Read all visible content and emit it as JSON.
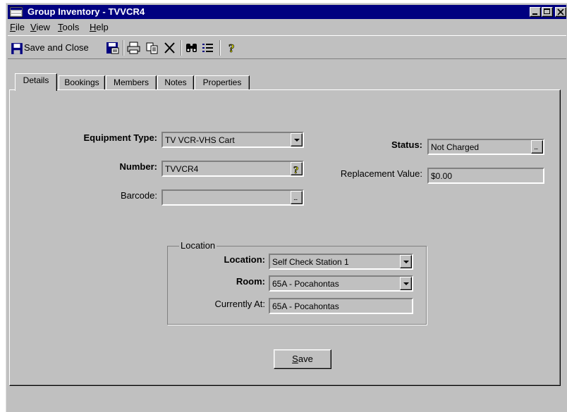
{
  "window": {
    "title": "Group Inventory - TVVCR4"
  },
  "menu": [
    {
      "label": "File",
      "hotkey": "F",
      "rest": "ile"
    },
    {
      "label": "View",
      "hotkey": "V",
      "rest": "iew"
    },
    {
      "label": "Tools",
      "hotkey": "T",
      "rest": "ools"
    },
    {
      "label": "Help",
      "hotkey": "H",
      "rest": "elp"
    }
  ],
  "toolbar": {
    "save_close_label": "Save and Close",
    "icons": [
      "save-disk-icon",
      "save-new-icon",
      "print-icon",
      "copy-icon",
      "delete-icon",
      "find-binoculars-icon",
      "list-icon",
      "help-question-icon"
    ]
  },
  "tabs": [
    "Details",
    "Bookings",
    "Members",
    "Notes",
    "Properties"
  ],
  "active_tab": "Details",
  "details": {
    "equipment_type_label": "Equipment Type:",
    "equipment_type_value": "TV VCR-VHS Cart",
    "number_label": "Number:",
    "number_value": "TVVCR4",
    "barcode_label": "Barcode:",
    "barcode_value": "",
    "status_label": "Status:",
    "status_value": "Not Charged",
    "replacement_label": "Replacement Value:",
    "replacement_value": "$0.00"
  },
  "location_group": {
    "title": "Location",
    "location_label": "Location:",
    "location_value": "Self Check Station 1",
    "room_label": "Room:",
    "room_value": "65A - Pocahontas",
    "currently_label": "Currently At:",
    "currently_value": "65A - Pocahontas"
  },
  "save_button": {
    "hotkey": "S",
    "rest": "ave"
  },
  "colors": {
    "titlebar": "#000080",
    "face": "#c0c0c0"
  }
}
